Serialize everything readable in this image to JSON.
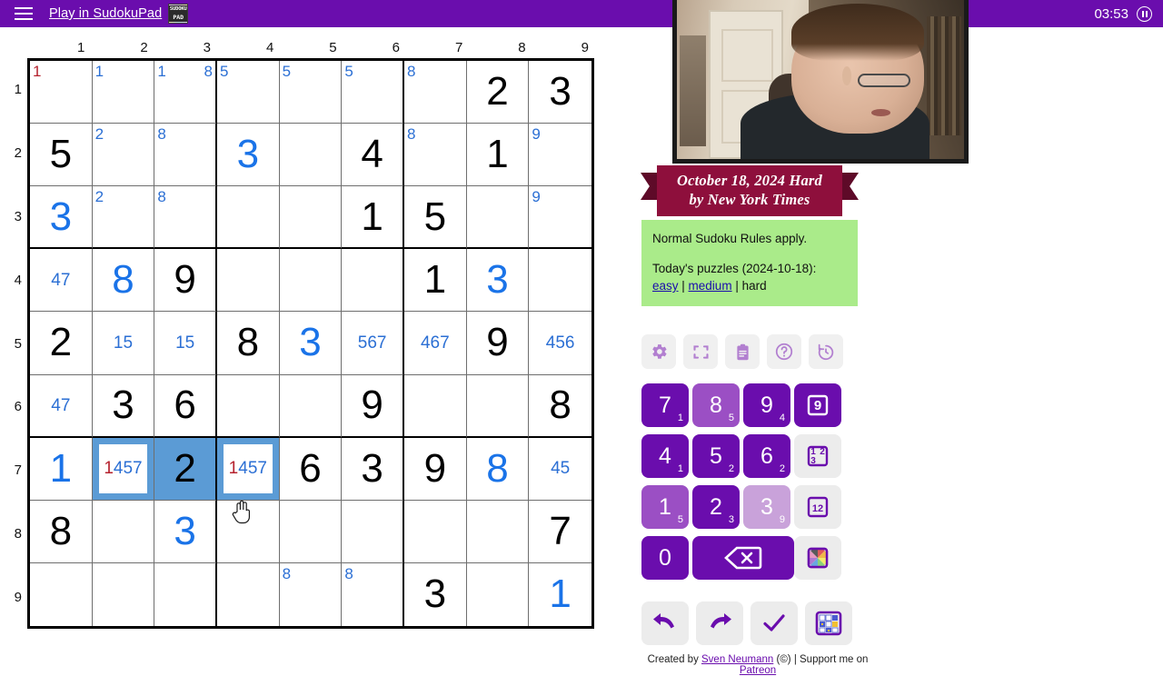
{
  "topbar": {
    "menu_icon": "hamburger-icon",
    "play_link": "Play in SudokuPad",
    "logo_top": "SUDOKU",
    "logo_bottom": "PAD",
    "timer": "03:53",
    "pause_icon": "pause-icon",
    "bg_color": "#6A0DAD"
  },
  "board": {
    "col_labels": [
      "1",
      "2",
      "3",
      "4",
      "5",
      "6",
      "7",
      "8",
      "9"
    ],
    "row_labels": [
      "1",
      "2",
      "3",
      "4",
      "5",
      "6",
      "7",
      "8",
      "9"
    ],
    "given_color": "#000000",
    "user_color": "#1a73e8",
    "pencil_color": "#2b6fd4",
    "conflict_color": "#b5222e",
    "selection_color": "#5b9bd5",
    "cells": [
      [
        {
          "corner": [
            {
              "d": "1",
              "pos": 1,
              "red": true
            }
          ]
        },
        {
          "corner": [
            {
              "d": "1",
              "pos": 1
            }
          ]
        },
        {
          "corner": [
            {
              "d": "1",
              "pos": 1
            },
            {
              "d": "8",
              "pos": 3
            }
          ]
        },
        {
          "corner": [
            {
              "d": "5",
              "pos": 1
            }
          ]
        },
        {
          "corner": [
            {
              "d": "5",
              "pos": 1
            }
          ]
        },
        {
          "corner": [
            {
              "d": "5",
              "pos": 1
            }
          ]
        },
        {
          "corner": [
            {
              "d": "8",
              "pos": 1
            }
          ]
        },
        {
          "value": "2",
          "type": "given"
        },
        {
          "value": "3",
          "type": "given"
        }
      ],
      [
        {
          "value": "5",
          "type": "given"
        },
        {
          "corner": [
            {
              "d": "2",
              "pos": 1
            }
          ]
        },
        {
          "corner": [
            {
              "d": "8",
              "pos": 1
            }
          ]
        },
        {
          "value": "3",
          "type": "user"
        },
        {},
        {
          "value": "4",
          "type": "given"
        },
        {
          "corner": [
            {
              "d": "8",
              "pos": 1
            }
          ]
        },
        {
          "value": "1",
          "type": "given"
        },
        {
          "corner": [
            {
              "d": "9",
              "pos": 1
            }
          ]
        }
      ],
      [
        {
          "value": "3",
          "type": "user"
        },
        {
          "corner": [
            {
              "d": "2",
              "pos": 1
            }
          ]
        },
        {
          "corner": [
            {
              "d": "8",
              "pos": 1
            }
          ]
        },
        {},
        {},
        {
          "value": "1",
          "type": "given"
        },
        {
          "value": "5",
          "type": "given"
        },
        {},
        {
          "corner": [
            {
              "d": "9",
              "pos": 1
            }
          ]
        }
      ],
      [
        {
          "centre": "47"
        },
        {
          "value": "8",
          "type": "user"
        },
        {
          "value": "9",
          "type": "given"
        },
        {},
        {},
        {},
        {
          "value": "1",
          "type": "given"
        },
        {
          "value": "3",
          "type": "user"
        },
        {}
      ],
      [
        {
          "value": "2",
          "type": "given"
        },
        {
          "centre": "15"
        },
        {
          "centre": "15"
        },
        {
          "value": "8",
          "type": "given"
        },
        {
          "value": "3",
          "type": "user"
        },
        {
          "centre": "567"
        },
        {
          "centre": "467"
        },
        {
          "value": "9",
          "type": "given"
        },
        {
          "centre": "456"
        }
      ],
      [
        {
          "centre": "47"
        },
        {
          "value": "3",
          "type": "given"
        },
        {
          "value": "6",
          "type": "given"
        },
        {},
        {},
        {
          "value": "9",
          "type": "given"
        },
        {},
        {},
        {
          "value": "8",
          "type": "given"
        }
      ],
      [
        {
          "value": "1",
          "type": "user"
        },
        {
          "centre": "1457",
          "centre_red_first": true,
          "selected": true
        },
        {
          "value": "2",
          "type": "given",
          "selband": true
        },
        {
          "centre": "1457",
          "centre_red_first": true,
          "selected": true
        },
        {
          "value": "6",
          "type": "given"
        },
        {
          "value": "3",
          "type": "given"
        },
        {
          "value": "9",
          "type": "given"
        },
        {
          "value": "8",
          "type": "user"
        },
        {
          "centre": "45"
        }
      ],
      [
        {
          "value": "8",
          "type": "given"
        },
        {},
        {
          "value": "3",
          "type": "user"
        },
        {},
        {},
        {},
        {},
        {},
        {
          "value": "7",
          "type": "given"
        }
      ],
      [
        {},
        {},
        {},
        {},
        {
          "corner": [
            {
              "d": "8",
              "pos": 1
            }
          ]
        },
        {
          "corner": [
            {
              "d": "8",
              "pos": 1
            }
          ]
        },
        {
          "value": "3",
          "type": "given"
        },
        {},
        {
          "value": "1",
          "type": "user"
        }
      ]
    ]
  },
  "panel": {
    "webcam": {
      "name": "webcam-overlay"
    },
    "title": {
      "line1": "October 18, 2024 Hard",
      "line2": "by New York Times",
      "color": "#8e0f3c"
    },
    "rules": {
      "line1": "Normal Sudoku Rules apply.",
      "line2_prefix": "Today's puzzles (2024-10-18):",
      "easy": "easy",
      "sep1": " | ",
      "medium": "medium",
      "sep2": " | ",
      "hard": "hard",
      "bg_color": "#aaeb8a"
    },
    "tools": [
      {
        "name": "settings-icon",
        "label": "Settings"
      },
      {
        "name": "fullscreen-icon",
        "label": "Fullscreen"
      },
      {
        "name": "rules-clipboard-icon",
        "label": "Rules"
      },
      {
        "name": "help-icon",
        "label": "Help"
      },
      {
        "name": "restart-icon",
        "label": "Restart"
      }
    ],
    "keypad": {
      "keys": [
        {
          "digit": "7",
          "count": "1",
          "shade": "full"
        },
        {
          "digit": "8",
          "count": "5",
          "shade": "mid"
        },
        {
          "digit": "9",
          "count": "4",
          "shade": "full"
        },
        {
          "digit": "4",
          "count": "1",
          "shade": "full"
        },
        {
          "digit": "5",
          "count": "2",
          "shade": "full"
        },
        {
          "digit": "6",
          "count": "2",
          "shade": "full"
        },
        {
          "digit": "1",
          "count": "5",
          "shade": "mid"
        },
        {
          "digit": "2",
          "count": "3",
          "shade": "full"
        },
        {
          "digit": "3",
          "count": "9",
          "shade": "light"
        }
      ],
      "zero": "0",
      "delete_icon": "delete-backspace-icon",
      "modes": [
        {
          "name": "normal-mode-button",
          "label": "9",
          "state": "active"
        },
        {
          "name": "corner-mode-button",
          "label": "123",
          "state": "idle"
        },
        {
          "name": "centre-mode-button",
          "label": "12",
          "state": "idle"
        },
        {
          "name": "colour-mode-button",
          "label": "colour",
          "state": "idle"
        }
      ]
    },
    "actions": [
      {
        "name": "undo-button",
        "icon": "undo-icon"
      },
      {
        "name": "redo-button",
        "icon": "redo-icon"
      },
      {
        "name": "check-button",
        "icon": "check-icon"
      },
      {
        "name": "grid-tools-button",
        "icon": "grid-icon"
      }
    ],
    "footer": {
      "prefix": "Created by ",
      "author": "Sven Neumann",
      "middle": " (©) | Support me on ",
      "patreon": "Patreon"
    }
  }
}
